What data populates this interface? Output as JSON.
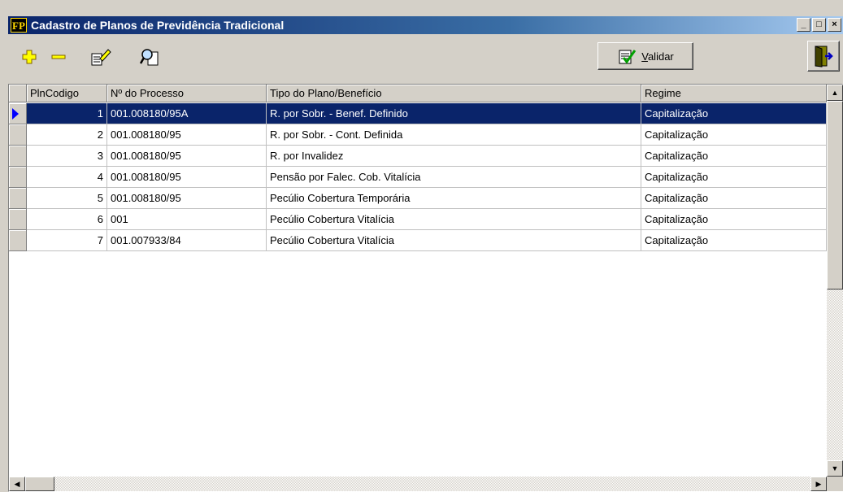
{
  "window": {
    "title": "Cadastro de Planos de Previdência Tradicional",
    "app_icon_text": "FP",
    "controls": {
      "minimize": "_",
      "maximize": "□",
      "close": "×"
    }
  },
  "toolbar": {
    "add_icon": "add-icon",
    "remove_icon": "remove-icon",
    "edit_icon": "edit-icon",
    "search_icon": "search-icon",
    "validar_label_underlined": "V",
    "validar_label_rest": "alidar",
    "exit_icon": "exit-door-icon"
  },
  "grid": {
    "columns": [
      "PlnCodigo",
      "Nº do Processo",
      "Tipo do Plano/Benefício",
      "Regime"
    ],
    "rows": [
      {
        "codigo": "1",
        "processo": "001.008180/95A",
        "tipo": "R. por Sobr. - Benef. Definido",
        "regime": "Capitalização",
        "selected": true
      },
      {
        "codigo": "2",
        "processo": "001.008180/95",
        "tipo": "R. por Sobr. - Cont. Definida",
        "regime": "Capitalização",
        "selected": false
      },
      {
        "codigo": "3",
        "processo": "001.008180/95",
        "tipo": "R. por Invalidez",
        "regime": "Capitalização",
        "selected": false
      },
      {
        "codigo": "4",
        "processo": "001.008180/95",
        "tipo": "Pensão por Falec. Cob. Vitalícia",
        "regime": "Capitalização",
        "selected": false
      },
      {
        "codigo": "5",
        "processo": "001.008180/95",
        "tipo": "Pecúlio Cobertura Temporária",
        "regime": "Capitalização",
        "selected": false
      },
      {
        "codigo": "6",
        "processo": "001",
        "tipo": "Pecúlio Cobertura Vitalícia",
        "regime": "Capitalização",
        "selected": false
      },
      {
        "codigo": "7",
        "processo": "001.007933/84",
        "tipo": "Pecúlio Cobertura Vitalícia",
        "regime": "Capitalização",
        "selected": false
      }
    ]
  },
  "colors": {
    "selection": "#0a246a",
    "title_start": "#0a246a",
    "face": "#d4d0c8"
  }
}
